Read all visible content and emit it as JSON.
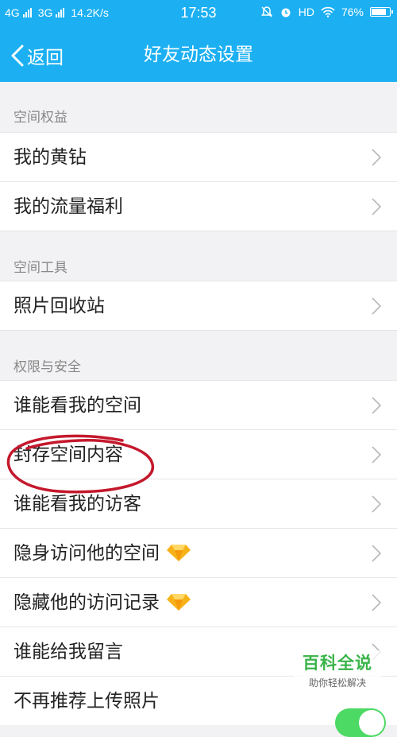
{
  "status_bar": {
    "net1": "4G",
    "net2": "3G",
    "speed": "14.2K/s",
    "time": "17:53",
    "hd": "HD",
    "battery_text": "76%",
    "battery_level": 0.76
  },
  "nav": {
    "back_label": "返回",
    "title": "好友动态设置"
  },
  "sections": [
    {
      "header": "空间权益",
      "items": [
        "我的黄钻",
        "我的流量福利"
      ]
    },
    {
      "header": "空间工具",
      "items": [
        "照片回收站"
      ]
    },
    {
      "header": "权限与安全",
      "items": [
        "谁能看我的空间",
        "封存空间内容",
        "谁能看我的访客",
        "隐身访问他的空间",
        "隐藏他的访问记录",
        "谁能给我留言",
        "不再推荐上传照片"
      ]
    }
  ],
  "watermark": {
    "title": "百科全说",
    "subtitle": "助你轻松解决"
  },
  "colors": {
    "brand_blue": "#1cb0f3",
    "annotation_red": "#c4182c",
    "toggle_green": "#4cd964",
    "watermark_green": "#3ab44a"
  }
}
